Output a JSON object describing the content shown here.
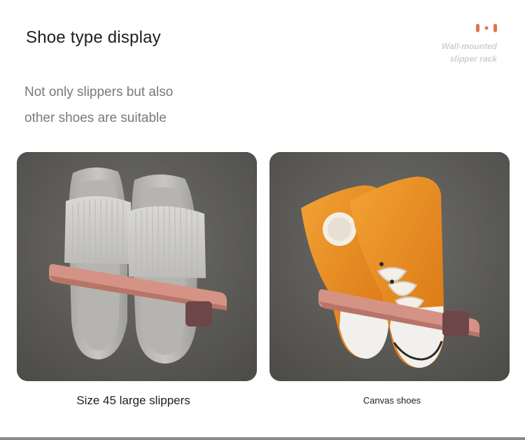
{
  "header": {
    "title": "Shoe type display",
    "subtitle_line1": "Not only slippers but also",
    "subtitle_line2": "other shoes are suitable"
  },
  "brand": {
    "line1": "Wall-mounted",
    "line2": "slipper rack",
    "accent_color": "#e0734f"
  },
  "panels": {
    "left_caption": "Size 45 large slippers",
    "right_caption": "Canvas shoes"
  },
  "colors": {
    "wall": "#5f5f5c",
    "rack_pink": "#d89a8c",
    "rack_cap": "#7a4e4e",
    "slipper_gray": "#c9c8c4",
    "canvas_orange": "#e88a1a"
  }
}
